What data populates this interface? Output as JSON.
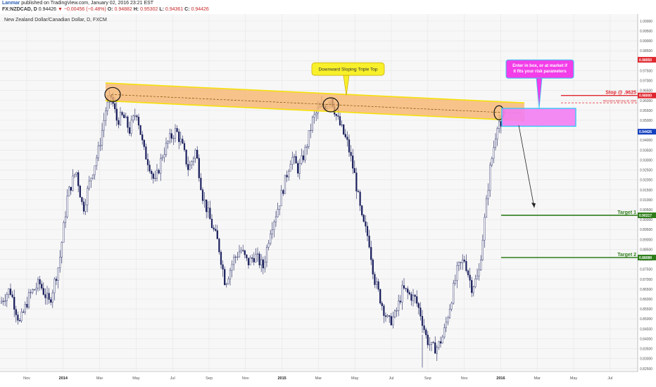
{
  "header": {
    "user": "Lanmar",
    "published": " published on TradingView.com, January 02, 2016 23:21 EST",
    "symbol": "FX:NZDCAD, D",
    "ohlc_text": [
      {
        "label": "",
        "value": "0.94426",
        "neg": false
      },
      {
        "label": "",
        "value": "▼ −0.00456 (−0.48%)",
        "neg": true
      },
      {
        "label": " O:",
        "value": "0.94882",
        "neg": true
      },
      {
        "label": " H:",
        "value": "0.95302",
        "neg": true
      },
      {
        "label": " L:",
        "value": "0.94361",
        "neg": true
      },
      {
        "label": " C:",
        "value": "0.94426",
        "neg": true
      }
    ]
  },
  "chart_data": {
    "type": "candlestick",
    "title": "New Zealand Dollar/Canadian Dollar, D, FXCM",
    "ylim": [
      0.8235,
      1.0035
    ],
    "y_ticks": [
      "1.00000",
      "0.99500",
      "0.99000",
      "0.98500",
      "0.98000",
      "0.97500",
      "0.97000",
      "0.96500",
      "0.96000",
      "0.95500",
      "0.95000",
      "0.94500",
      "0.94000",
      "0.93500",
      "0.93000",
      "0.92500",
      "0.92000",
      "0.91500",
      "0.91000",
      "0.90500",
      "0.90000",
      "0.89500",
      "0.89000",
      "0.88500",
      "0.88000",
      "0.87500",
      "0.87000",
      "0.86500",
      "0.86000",
      "0.85500",
      "0.85000",
      "0.84500",
      "0.84000",
      "0.83500",
      "0.83000",
      "0.82500"
    ],
    "x_ticks": [
      "Nov",
      "2014",
      "Mar",
      "May",
      "Jul",
      "Sep",
      "Nov",
      "2015",
      "Mar",
      "May",
      "Jul",
      "Sep",
      "Nov",
      "2016",
      "Mar",
      "May",
      "Jul"
    ],
    "price_path": [
      [
        0,
        0.858
      ],
      [
        14,
        0.865
      ],
      [
        28,
        0.848
      ],
      [
        42,
        0.862
      ],
      [
        56,
        0.868
      ],
      [
        70,
        0.858
      ],
      [
        84,
        0.878
      ],
      [
        96,
        0.912
      ],
      [
        108,
        0.925
      ],
      [
        118,
        0.905
      ],
      [
        128,
        0.92
      ],
      [
        140,
        0.935
      ],
      [
        150,
        0.955
      ],
      [
        158,
        0.962
      ],
      [
        166,
        0.95
      ],
      [
        175,
        0.952
      ],
      [
        184,
        0.945
      ],
      [
        194,
        0.955
      ],
      [
        204,
        0.935
      ],
      [
        212,
        0.928
      ],
      [
        220,
        0.918
      ],
      [
        230,
        0.932
      ],
      [
        240,
        0.94
      ],
      [
        250,
        0.945
      ],
      [
        258,
        0.938
      ],
      [
        268,
        0.925
      ],
      [
        278,
        0.935
      ],
      [
        288,
        0.912
      ],
      [
        300,
        0.898
      ],
      [
        310,
        0.888
      ],
      [
        320,
        0.868
      ],
      [
        332,
        0.88
      ],
      [
        342,
        0.885
      ],
      [
        352,
        0.878
      ],
      [
        362,
        0.882
      ],
      [
        374,
        0.876
      ],
      [
        384,
        0.895
      ],
      [
        394,
        0.905
      ],
      [
        404,
        0.918
      ],
      [
        414,
        0.932
      ],
      [
        424,
        0.925
      ],
      [
        434,
        0.935
      ],
      [
        444,
        0.95
      ],
      [
        452,
        0.955
      ],
      [
        462,
        0.958
      ],
      [
        470,
        0.962
      ],
      [
        478,
        0.952
      ],
      [
        486,
        0.945
      ],
      [
        494,
        0.938
      ],
      [
        504,
        0.922
      ],
      [
        514,
        0.9
      ],
      [
        524,
        0.89
      ],
      [
        532,
        0.87
      ],
      [
        542,
        0.858
      ],
      [
        552,
        0.848
      ],
      [
        562,
        0.852
      ],
      [
        572,
        0.865
      ],
      [
        582,
        0.862
      ],
      [
        590,
        0.86
      ],
      [
        598,
        0.852
      ],
      [
        606,
        0.84
      ],
      [
        614,
        0.835
      ],
      [
        622,
        0.836
      ],
      [
        630,
        0.842
      ],
      [
        640,
        0.858
      ],
      [
        650,
        0.875
      ],
      [
        660,
        0.88
      ],
      [
        670,
        0.866
      ],
      [
        680,
        0.872
      ],
      [
        690,
        0.905
      ],
      [
        696,
        0.925
      ],
      [
        702,
        0.938
      ],
      [
        708,
        0.952
      ],
      [
        712,
        0.944
      ]
    ],
    "annotations": {
      "triple_top_label": "Downward Sloping Triple Top",
      "box_label": "Enter in box, or at market if it fits your risk parameters",
      "stop_label": "Stop @ .9625",
      "alt_stop_label": "Alternative tight stop @ .9565",
      "target1_label": "Target 1",
      "target2_label": "Target 2"
    },
    "price_tags": {
      "stop_tag": "0.98000",
      "upper_tag": "0.98050",
      "current_tag": "0.94426",
      "target1_tag": "0.90217",
      "target2_tag": "0.88089"
    },
    "colors": {
      "candle": "#1a1f5c",
      "channel_fill": "#f7b267",
      "channel_edge": "#f5e10a",
      "box_fill": "#f27df2",
      "box_edge": "#35c7f5",
      "stop": "#e0262e",
      "target": "#2e7d1a",
      "current": "#1440c0"
    }
  }
}
